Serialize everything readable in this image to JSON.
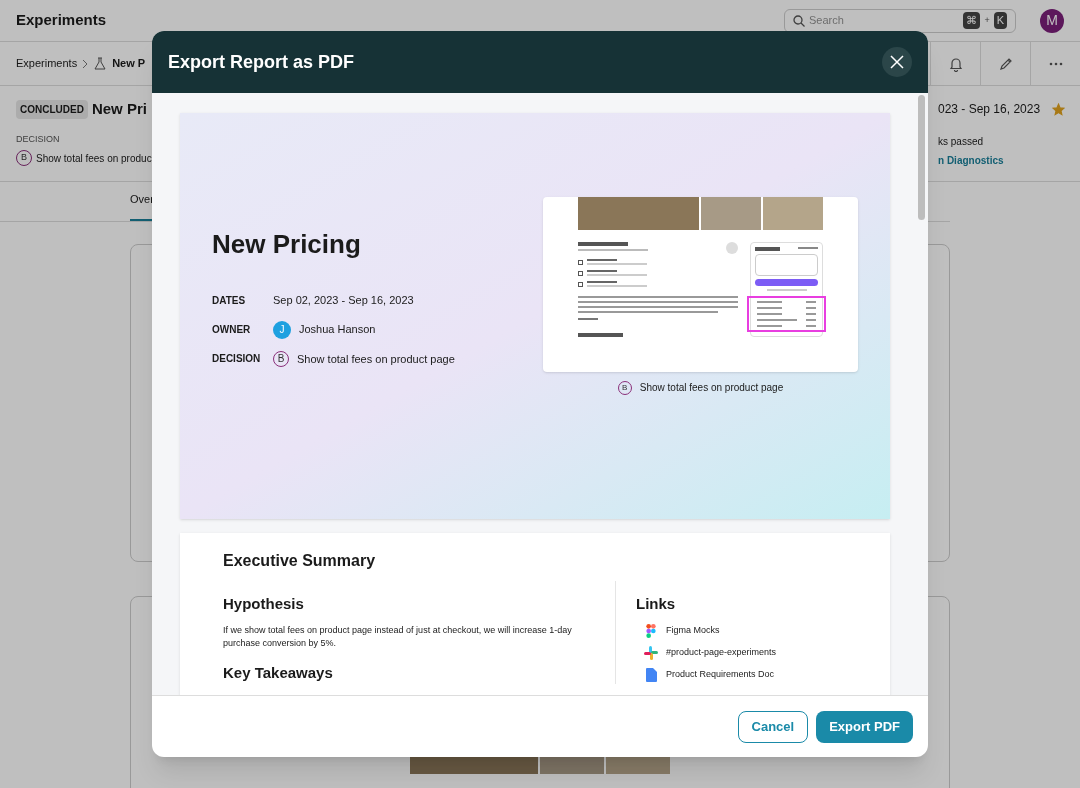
{
  "app": {
    "title": "Experiments",
    "search": {
      "placeholder": "Search"
    },
    "shortcut": [
      "⌘",
      "+",
      "K"
    ],
    "avatar": "M"
  },
  "breadcrumb": [
    "Experiments",
    "New P"
  ],
  "experiment": {
    "status": "CONCLUDED",
    "title": "New Pri",
    "decision_label": "DECISION",
    "variant": "B",
    "decision": "Show total fees on produc",
    "dates": "023 - Sep 16, 2023",
    "starred": true,
    "checks": "ks passed",
    "link": "n Diagnostics"
  },
  "tabs": [
    {
      "label": "Over",
      "selected": true
    }
  ],
  "modal": {
    "title": "Export Report as PDF",
    "cover": {
      "title": "New Pricing",
      "fields": [
        {
          "kind": "text",
          "label": "DATES",
          "value": "Sep 02, 2023 - Sep 16, 2023"
        },
        {
          "kind": "person",
          "label": "OWNER",
          "initial": "J",
          "value": "Joshua Hanson"
        },
        {
          "kind": "variant",
          "label": "DECISION",
          "badge": "B",
          "value": "Show total fees on product page"
        }
      ],
      "caption": {
        "badge": "B",
        "text": "Show total fees on product page"
      }
    },
    "summary": {
      "title": "Executive Summary",
      "hypothesis_heading": "Hypothesis",
      "hypothesis": "If we show total fees on product page instead of just at checkout, we will increase 1-day purchase conversion by 5%.",
      "takeaways_heading": "Key Takeaways",
      "links_heading": "Links",
      "links": [
        {
          "kind": "figma",
          "label": "Figma Mocks"
        },
        {
          "kind": "slack",
          "label": "#product-page-experiments"
        },
        {
          "kind": "doc",
          "label": "Product Requirements Doc"
        }
      ]
    },
    "buttons": {
      "cancel": "Cancel",
      "export": "Export PDF"
    }
  }
}
